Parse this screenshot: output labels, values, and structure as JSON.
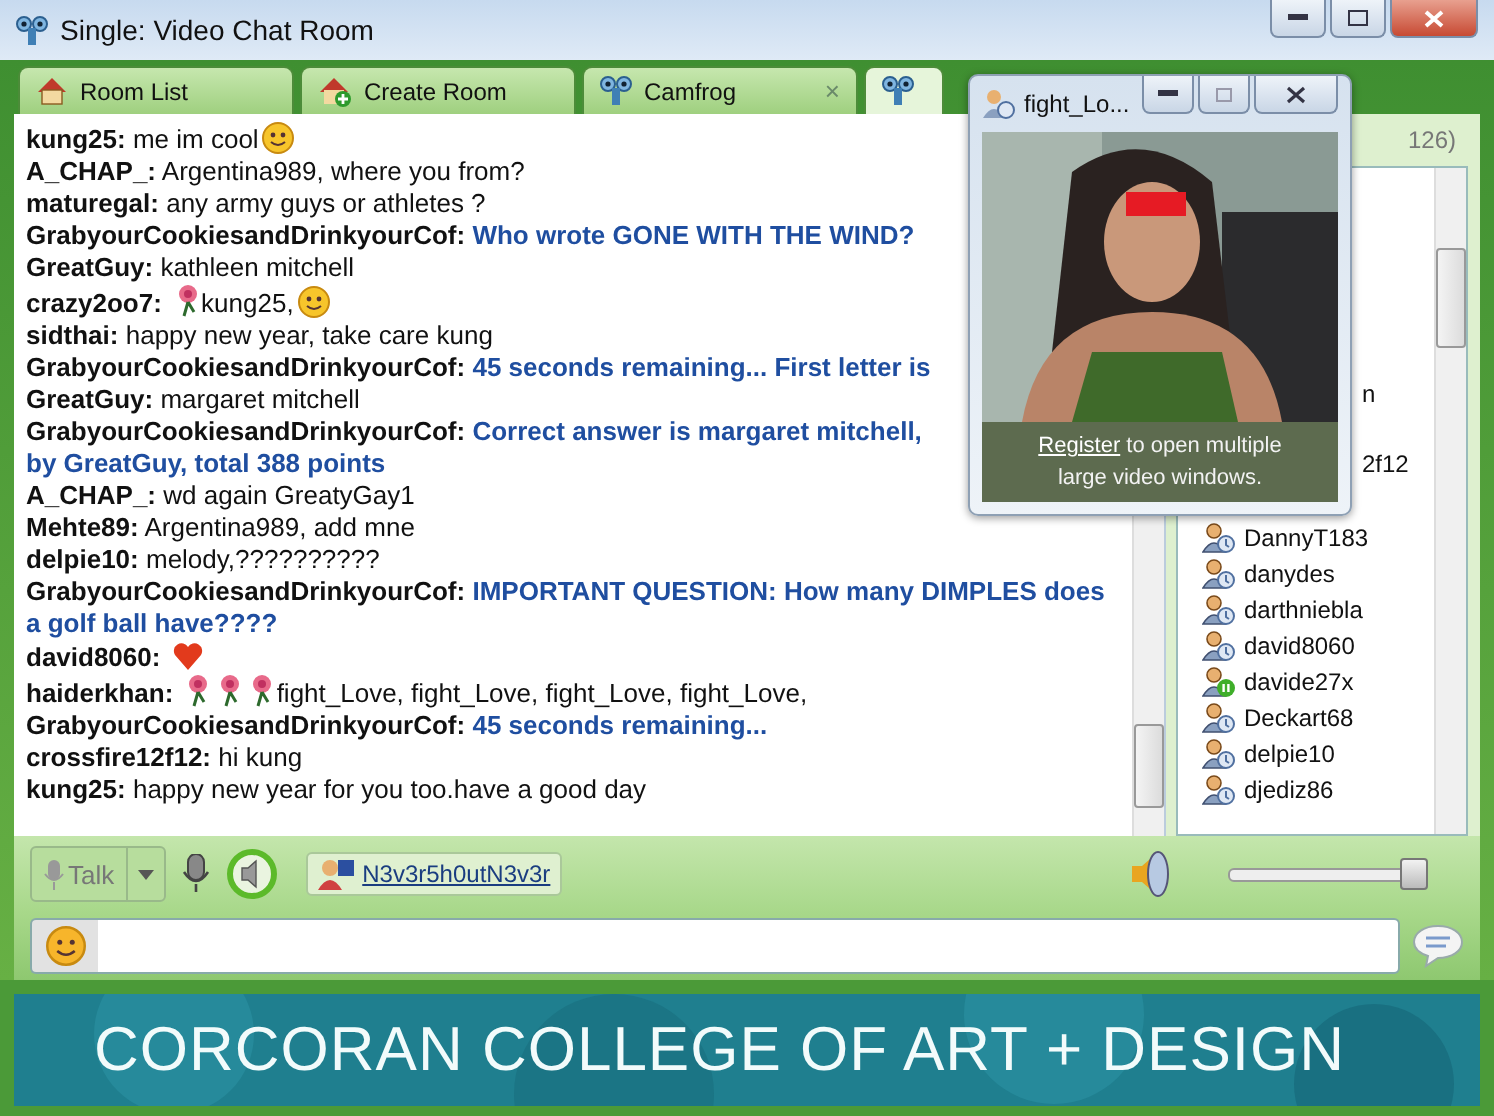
{
  "window": {
    "title": "Single: Video Chat Room"
  },
  "tabs": [
    {
      "label": "Room List",
      "kind": "home",
      "selected": false
    },
    {
      "label": "Create Room",
      "kind": "create",
      "selected": false
    },
    {
      "label": "Camfrog",
      "kind": "room",
      "selected": false,
      "close": "×"
    },
    {
      "kind": "room",
      "selected": true
    }
  ],
  "chat": {
    "messages": [
      {
        "user": "kung25:",
        "parts": [
          {
            "kind": "text",
            "text": "me im cool"
          },
          {
            "kind": "smiley"
          }
        ]
      },
      {
        "user": "A_CHAP_:",
        "parts": [
          {
            "kind": "text",
            "text": "Argentina989, where you from?"
          }
        ]
      },
      {
        "user": "maturegal:",
        "parts": [
          {
            "kind": "text",
            "text": "any army guys or athletes ?"
          }
        ]
      },
      {
        "user": "GrabyourCookiesandDrinkyourCof:",
        "parts": [
          {
            "kind": "bot",
            "text": "Who wrote GONE WITH THE WIND?"
          }
        ]
      },
      {
        "user": "GreatGuy:",
        "parts": [
          {
            "kind": "text",
            "text": "kathleen mitchell"
          }
        ]
      },
      {
        "user": "crazy2oo7:",
        "parts": [
          {
            "kind": "flower"
          },
          {
            "kind": "text",
            "text": "kung25,"
          },
          {
            "kind": "smiley"
          }
        ]
      },
      {
        "user": "sidthai:",
        "parts": [
          {
            "kind": "text",
            "text": "happy new year, take care kung"
          }
        ]
      },
      {
        "user": "GrabyourCookiesandDrinkyourCof:",
        "parts": [
          {
            "kind": "bot",
            "text": "45 seconds remaining... First letter is"
          }
        ]
      },
      {
        "user": "GreatGuy:",
        "parts": [
          {
            "kind": "text",
            "text": "margaret mitchell"
          }
        ]
      },
      {
        "user": "GrabyourCookiesandDrinkyourCof:",
        "parts": [
          {
            "kind": "bot",
            "text": "Correct answer is margaret mitchell,"
          },
          {
            "kind": "break"
          },
          {
            "kind": "bot",
            "text": "by GreatGuy, total 388 points"
          }
        ]
      },
      {
        "user": "A_CHAP_:",
        "parts": [
          {
            "kind": "text",
            "text": "wd again GreatyGay1"
          }
        ]
      },
      {
        "user": "Mehte89:",
        "parts": [
          {
            "kind": "text",
            "text": "Argentina989, add mne"
          }
        ]
      },
      {
        "user": "delpie10:",
        "parts": [
          {
            "kind": "text",
            "text": "melody,??????????"
          }
        ]
      },
      {
        "user": "GrabyourCookiesandDrinkyourCof:",
        "parts": [
          {
            "kind": "bot",
            "text": "IMPORTANT QUESTION: How many DIMPLES does"
          },
          {
            "kind": "break"
          },
          {
            "kind": "bot",
            "text": "a golf ball have????"
          }
        ]
      },
      {
        "user": "david8060:",
        "parts": [
          {
            "kind": "heart"
          }
        ]
      },
      {
        "user": "haiderkhan:",
        "parts": [
          {
            "kind": "flower"
          },
          {
            "kind": "flower"
          },
          {
            "kind": "flower"
          },
          {
            "kind": "text",
            "text": "fight_Love, fight_Love, fight_Love, fight_Love,"
          }
        ]
      },
      {
        "user": "GrabyourCookiesandDrinkyourCof:",
        "parts": [
          {
            "kind": "bot",
            "text": "45 seconds remaining..."
          }
        ]
      },
      {
        "user": "crossfire12f12:",
        "parts": [
          {
            "kind": "text",
            "text": "hi kung"
          }
        ]
      },
      {
        "user": "kung25:",
        "parts": [
          {
            "kind": "text",
            "text": "happy new year for you too.have a good day"
          }
        ]
      }
    ]
  },
  "users": {
    "count": "126)",
    "items": [
      {
        "name": "n",
        "kind": "cut"
      },
      {
        "name": "2f12",
        "kind": "cut"
      },
      {
        "name": "DannyT183",
        "kind": "user"
      },
      {
        "name": "danydes",
        "kind": "user"
      },
      {
        "name": "darthniebla",
        "kind": "user"
      },
      {
        "name": "david8060",
        "kind": "user"
      },
      {
        "name": "davide27x",
        "kind": "paused"
      },
      {
        "name": "Deckart68",
        "kind": "user"
      },
      {
        "name": "delpie10",
        "kind": "user"
      },
      {
        "name": "djediz86",
        "kind": "user"
      }
    ]
  },
  "toolbar": {
    "talk": {
      "label": "Talk",
      "disabled": true
    },
    "speaking_user": "N3v3r5h0utN3v3r",
    "volume": {
      "level": 0.95
    }
  },
  "video_window": {
    "title": "fight_Lo...",
    "link": "Register",
    "caption": "to open multiple large video windows."
  },
  "banner": {
    "text": "CORCORAN COLLEGE OF ART + DESIGN"
  }
}
